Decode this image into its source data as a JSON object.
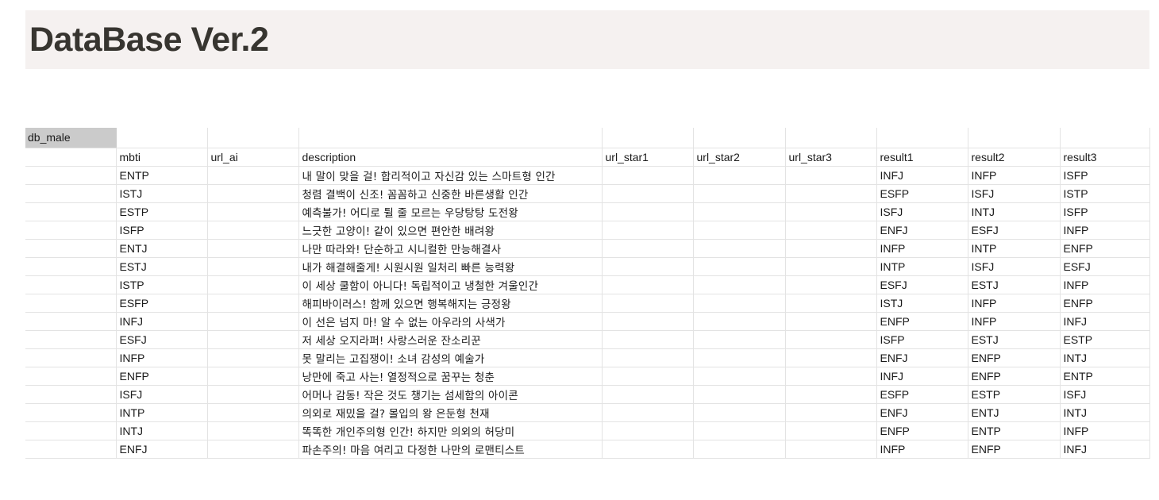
{
  "page_title": "DataBase Ver.2",
  "sheet": {
    "name": "db_male",
    "columns": [
      "mbti",
      "url_ai",
      "description",
      "url_star1",
      "url_star2",
      "url_star3",
      "result1",
      "result2",
      "result3"
    ],
    "rows": [
      {
        "mbti": "ENTP",
        "url_ai": "",
        "description": "내 말이 맞을 걸! 합리적이고 자신감 있는 스마트형 인간",
        "url_star1": "",
        "url_star2": "",
        "url_star3": "",
        "result1": "INFJ",
        "result2": "INFP",
        "result3": "ISFP"
      },
      {
        "mbti": "ISTJ",
        "url_ai": "",
        "description": "청렴 결백이 신조! 꼼꼼하고 신중한 바른생활 인간",
        "url_star1": "",
        "url_star2": "",
        "url_star3": "",
        "result1": "ESFP",
        "result2": "ISFJ",
        "result3": "ISTP"
      },
      {
        "mbti": "ESTP",
        "url_ai": "",
        "description": "예측불가! 어디로 튈 줄 모르는 우당탕탕 도전왕",
        "url_star1": "",
        "url_star2": "",
        "url_star3": "",
        "result1": "ISFJ",
        "result2": "INTJ",
        "result3": "ISFP"
      },
      {
        "mbti": "ISFP",
        "url_ai": "",
        "description": "느긋한 고양이! 같이 있으면 편안한 배려왕",
        "url_star1": "",
        "url_star2": "",
        "url_star3": "",
        "result1": "ENFJ",
        "result2": "ESFJ",
        "result3": "INFP"
      },
      {
        "mbti": "ENTJ",
        "url_ai": "",
        "description": "나만 따라와! 단순하고 시니컬한 만능해결사",
        "url_star1": "",
        "url_star2": "",
        "url_star3": "",
        "result1": "INFP",
        "result2": "INTP",
        "result3": "ENFP"
      },
      {
        "mbti": "ESTJ",
        "url_ai": "",
        "description": "내가 해결해줄게! 시원시원 일처리 빠른 능력왕",
        "url_star1": "",
        "url_star2": "",
        "url_star3": "",
        "result1": "INTP",
        "result2": "ISFJ",
        "result3": "ESFJ"
      },
      {
        "mbti": "ISTP",
        "url_ai": "",
        "description": "이 세상 쿨함이 아니다! 독립적이고 냉철한 겨울인간",
        "url_star1": "",
        "url_star2": "",
        "url_star3": "",
        "result1": "ESFJ",
        "result2": "ESTJ",
        "result3": "INFP"
      },
      {
        "mbti": "ESFP",
        "url_ai": "",
        "description": "해피바이러스! 함께 있으면 행복해지는 긍정왕",
        "url_star1": "",
        "url_star2": "",
        "url_star3": "",
        "result1": "ISTJ",
        "result2": "INFP",
        "result3": "ENFP"
      },
      {
        "mbti": "INFJ",
        "url_ai": "",
        "description": "이 선은 넘지 마! 알 수 없는 아우라의 사색가",
        "url_star1": "",
        "url_star2": "",
        "url_star3": "",
        "result1": "ENFP",
        "result2": "INFP",
        "result3": "INFJ"
      },
      {
        "mbti": "ESFJ",
        "url_ai": "",
        "description": "저 세상 오지라퍼! 사랑스러운 잔소리꾼",
        "url_star1": "",
        "url_star2": "",
        "url_star3": "",
        "result1": "ISFP",
        "result2": "ESTJ",
        "result3": "ESTP"
      },
      {
        "mbti": "INFP",
        "url_ai": "",
        "description": "못 말리는 고집쟁이! 소녀 감성의 예술가",
        "url_star1": "",
        "url_star2": "",
        "url_star3": "",
        "result1": "ENFJ",
        "result2": "ENFP",
        "result3": "INTJ"
      },
      {
        "mbti": "ENFP",
        "url_ai": "",
        "description": "낭만에 죽고 사는! 열정적으로 꿈꾸는 청춘",
        "url_star1": "",
        "url_star2": "",
        "url_star3": "",
        "result1": "INFJ",
        "result2": "ENFP",
        "result3": "ENTP"
      },
      {
        "mbti": "ISFJ",
        "url_ai": "",
        "description": "어머나 감동! 작은 것도 챙기는 섬세함의 아이콘",
        "url_star1": "",
        "url_star2": "",
        "url_star3": "",
        "result1": "ESFP",
        "result2": "ESTP",
        "result3": "ISFJ"
      },
      {
        "mbti": "INTP",
        "url_ai": "",
        "description": "의외로 재밌을 걸? 몰입의 왕 은둔형 천재",
        "url_star1": "",
        "url_star2": "",
        "url_star3": "",
        "result1": "ENFJ",
        "result2": "ENTJ",
        "result3": "INTJ"
      },
      {
        "mbti": "INTJ",
        "url_ai": "",
        "description": "똑똑한 개인주의형 인간! 하지만 의외의 허당미",
        "url_star1": "",
        "url_star2": "",
        "url_star3": "",
        "result1": "ENFP",
        "result2": "ENTP",
        "result3": "INFP"
      },
      {
        "mbti": "ENFJ",
        "url_ai": "",
        "description": "파손주의! 마음 여리고 다정한 나만의 로맨티스트",
        "url_star1": "",
        "url_star2": "",
        "url_star3": "",
        "result1": "INFP",
        "result2": "ENFP",
        "result3": "INFJ"
      }
    ]
  }
}
